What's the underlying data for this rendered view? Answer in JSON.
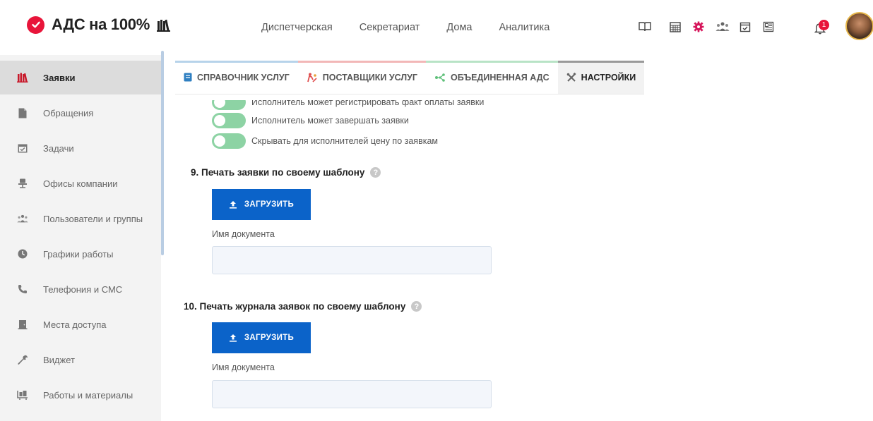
{
  "app": {
    "logo_text": "АДС на 100%",
    "brand_color": "#e8153a",
    "accent_color": "#0b63c9",
    "toggle_color": "#8dd3a4"
  },
  "nav": {
    "items": [
      "Диспетчерская",
      "Секретариат",
      "Дома",
      "Аналитика"
    ]
  },
  "header_icons": [
    "book-open-icon",
    "calendar-grid-icon",
    "gear-icon",
    "users-icon",
    "calendar-check-icon",
    "newspaper-icon",
    "bell-icon"
  ],
  "notifications": {
    "count": "1"
  },
  "sidebar": {
    "items": [
      {
        "label": "Заявки",
        "icon": "books-icon",
        "active": true
      },
      {
        "label": "Обращения",
        "icon": "document-icon"
      },
      {
        "label": "Задачи",
        "icon": "calendar-check-icon"
      },
      {
        "label": "Офисы компании",
        "icon": "desk-chair-icon"
      },
      {
        "label": "Пользователи и группы",
        "icon": "users-icon"
      },
      {
        "label": "Графики работы",
        "icon": "clock-icon"
      },
      {
        "label": "Телефония и СМС",
        "icon": "phone-icon"
      },
      {
        "label": "Места доступа",
        "icon": "door-icon"
      },
      {
        "label": "Виджет",
        "icon": "wrench-icon"
      },
      {
        "label": "Работы и материалы",
        "icon": "cart-icon"
      }
    ]
  },
  "tabs": [
    {
      "label": "СПРАВОЧНИК УСЛУГ",
      "color": "#b7d3ea",
      "icon": "book-icon"
    },
    {
      "label": "ПОСТАВЩИКИ УСЛУГ",
      "color": "#f2b7b7",
      "icon": "workers-icon"
    },
    {
      "label": "ОБЪЕДИНЕННАЯ АДС",
      "color": "#b8e3c6",
      "icon": "network-icon"
    },
    {
      "label": "НАСТРОЙКИ",
      "color": "#9a9a9a",
      "icon": "tools-icon",
      "active": true
    }
  ],
  "toggles": [
    {
      "label": "Исполнитель может регистрировать факт оплаты заявки",
      "on": false
    },
    {
      "label": "Исполнитель может завершать заявки",
      "on": false
    },
    {
      "label": "Скрывать для исполнителей цену по заявкам",
      "on": false
    }
  ],
  "sections": [
    {
      "title": "9. Печать заявки по своему шаблону",
      "help": "?",
      "upload_label": "ЗАГРУЗИТЬ",
      "field_label": "Имя документа",
      "field_value": ""
    },
    {
      "title": "10. Печать журнала заявок по своему шаблону",
      "help": "?",
      "upload_label": "ЗАГРУЗИТЬ",
      "field_label": "Имя документа",
      "field_value": ""
    }
  ]
}
